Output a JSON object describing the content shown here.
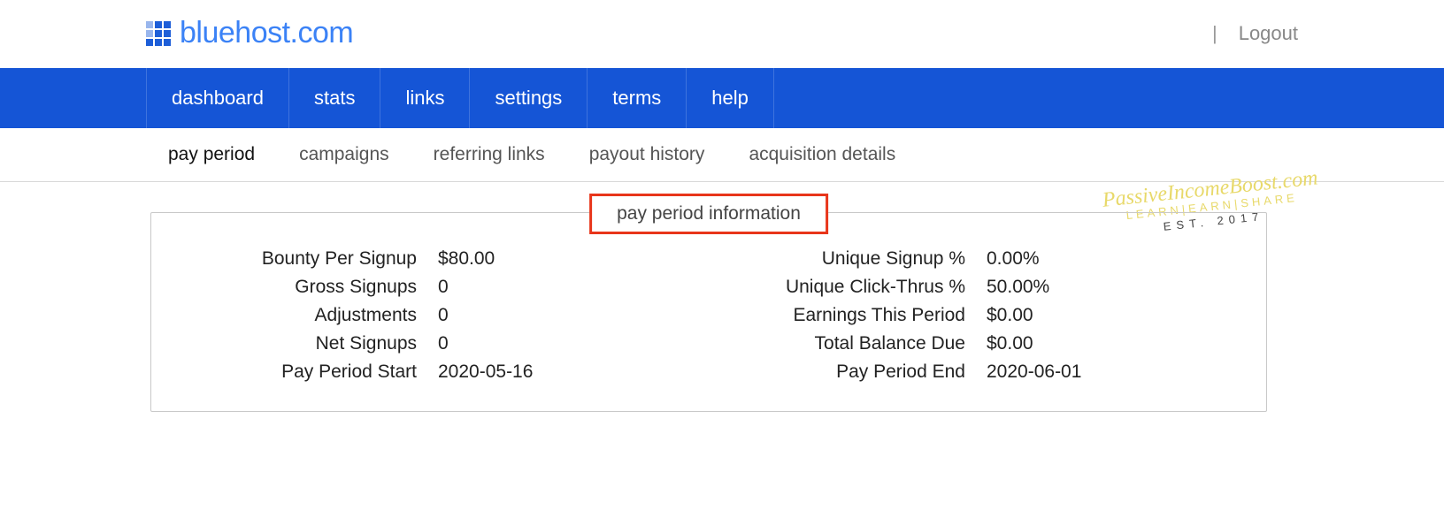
{
  "header": {
    "brand": "bluehost.com",
    "logout": "Logout"
  },
  "main_nav": [
    "dashboard",
    "stats",
    "links",
    "settings",
    "terms",
    "help"
  ],
  "sub_nav": [
    "pay period",
    "campaigns",
    "referring links",
    "payout history",
    "acquisition details"
  ],
  "panel": {
    "title": "pay period information",
    "left": [
      {
        "label": "Bounty Per Signup",
        "value": "$80.00"
      },
      {
        "label": "Gross Signups",
        "value": "0"
      },
      {
        "label": "Adjustments",
        "value": "0"
      },
      {
        "label": "Net Signups",
        "value": "0"
      },
      {
        "label": "Pay Period Start",
        "value": "2020-05-16"
      }
    ],
    "right": [
      {
        "label": "Unique Signup %",
        "value": "0.00%"
      },
      {
        "label": "Unique Click-Thrus %",
        "value": "50.00%"
      },
      {
        "label": "Earnings This Period",
        "value": "$0.00"
      },
      {
        "label": "Total Balance Due",
        "value": "$0.00"
      },
      {
        "label": "Pay Period End",
        "value": "2020-06-01"
      }
    ]
  },
  "watermark": {
    "line1": "PassiveIncomeBoost.com",
    "line2": "LEARN|EARN|SHARE",
    "line3": "EST. 2017"
  }
}
